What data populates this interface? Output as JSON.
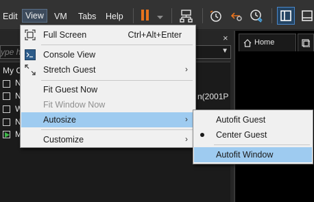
{
  "menubar": {
    "items": [
      {
        "label": "Edit"
      },
      {
        "label": "View"
      },
      {
        "label": "VM"
      },
      {
        "label": "Tabs"
      },
      {
        "label": "Help"
      }
    ]
  },
  "library": {
    "search_placeholder": "ype h",
    "root_label": "My C",
    "rows": [
      "N",
      "N",
      "W",
      "N",
      "M"
    ],
    "partial_vm_name": "n(2001P",
    "close_glyph": "×"
  },
  "tabs": [
    {
      "label": "Home"
    }
  ],
  "view_menu": {
    "items": [
      {
        "label": "Full Screen",
        "accel": "Ctrl+Alt+Enter"
      },
      {
        "label": "Console View"
      },
      {
        "label": "Stretch Guest",
        "submenu": true
      },
      {
        "label": "Fit Guest Now"
      },
      {
        "label": "Fit Window Now",
        "disabled": true
      },
      {
        "label": "Autosize",
        "submenu": true,
        "highlighted": true
      },
      {
        "label": "Customize",
        "submenu": true
      }
    ]
  },
  "autosize_menu": {
    "items": [
      {
        "label": "Autofit Guest"
      },
      {
        "label": "Center Guest",
        "checked": true
      },
      {
        "label": "Autofit Window",
        "highlighted": true
      }
    ]
  },
  "colors": {
    "accent_pause": "#e8731d",
    "menu_highlight": "#9ecbf0",
    "run_green": "#3fb84a"
  }
}
